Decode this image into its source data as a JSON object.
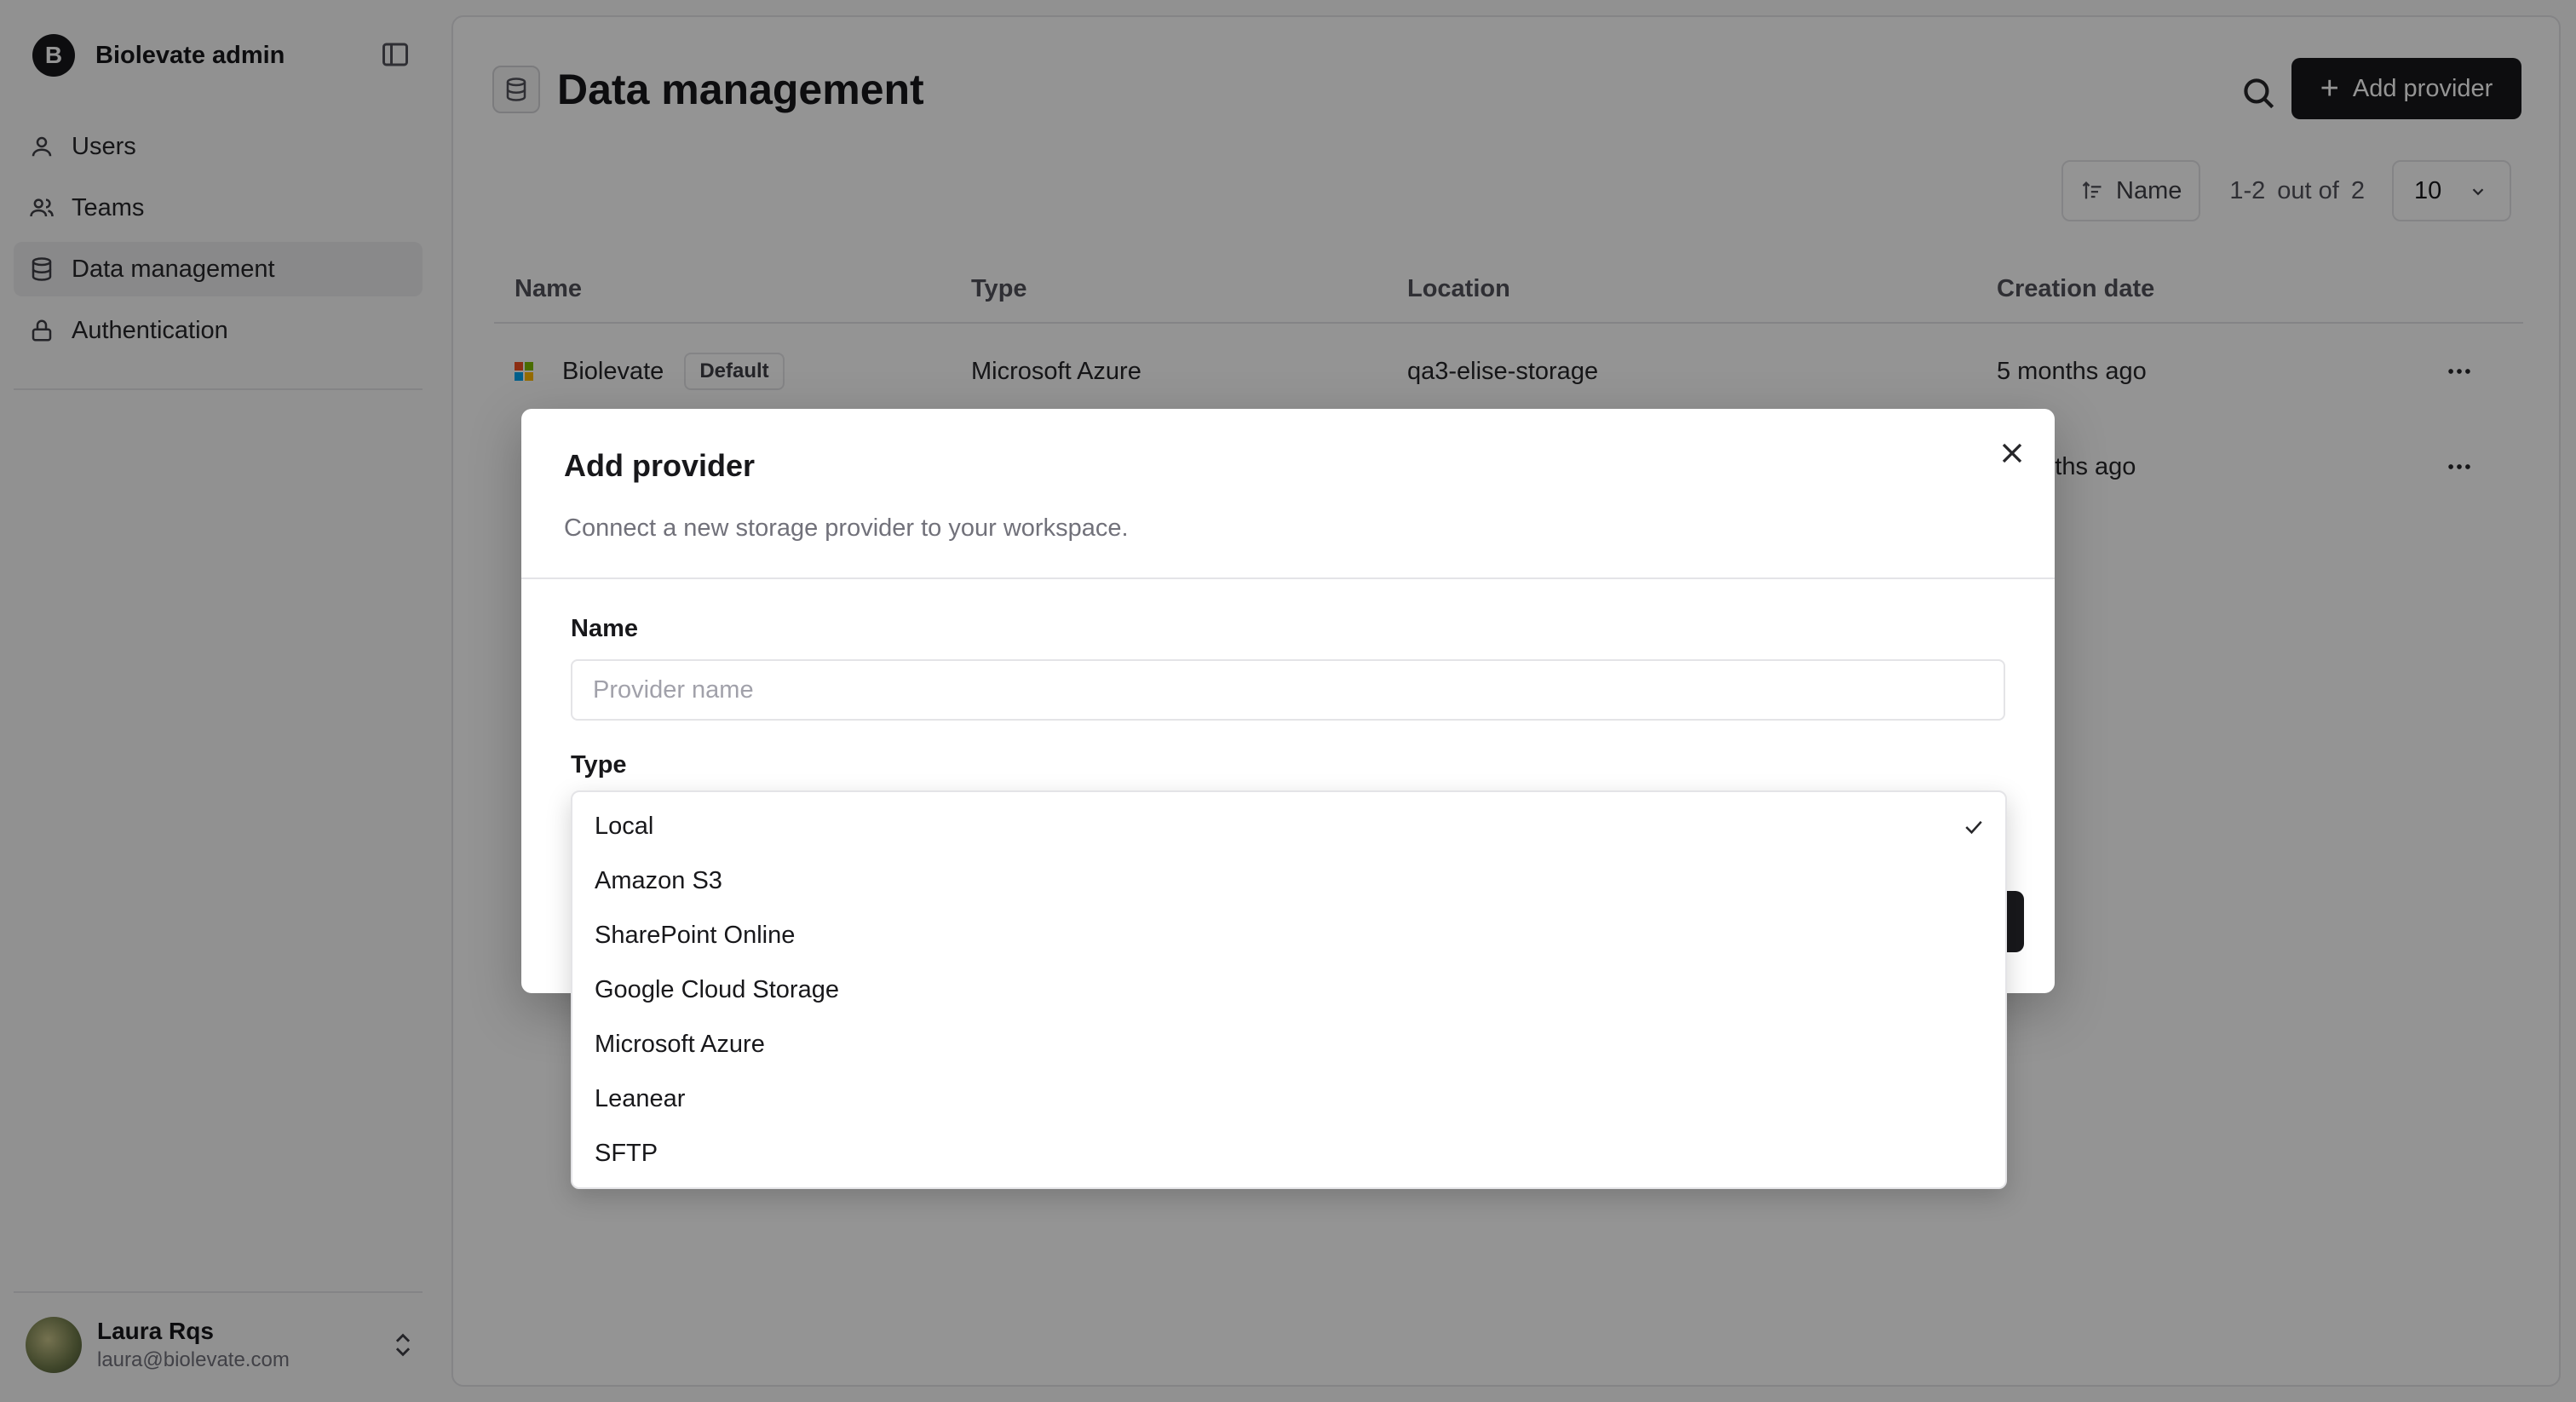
{
  "app": {
    "name": "Biolevate admin",
    "logo_letter": "B"
  },
  "sidebar": {
    "items": [
      {
        "label": "Users",
        "icon": "user-icon",
        "active": false
      },
      {
        "label": "Teams",
        "icon": "users-icon",
        "active": false
      },
      {
        "label": "Data management",
        "icon": "database-icon",
        "active": true
      },
      {
        "label": "Authentication",
        "icon": "lock-icon",
        "active": false
      }
    ],
    "user": {
      "name": "Laura Rqs",
      "email": "laura@biolevate.com"
    }
  },
  "page": {
    "title": "Data management",
    "add_label": "Add provider",
    "sort_label": "Name",
    "pager": {
      "range": "1-2",
      "out_of": "out of",
      "total": "2"
    },
    "page_size": "10"
  },
  "table": {
    "headers": {
      "name": "Name",
      "type": "Type",
      "location": "Location",
      "date": "Creation date"
    },
    "rows": [
      {
        "name": "Biolevate",
        "badge": "Default",
        "type": "Microsoft Azure",
        "location": "qa3-elise-storage",
        "date": "5 months ago"
      },
      {
        "name": "",
        "badge": "",
        "type": "",
        "location": "",
        "date": "onths ago"
      }
    ]
  },
  "dialog": {
    "title": "Add provider",
    "subtitle": "Connect a new storage provider to your workspace.",
    "name_label": "Name",
    "name_placeholder": "Provider name",
    "type_label": "Type",
    "type_options": [
      "Local",
      "Amazon S3",
      "SharePoint Online",
      "Google Cloud Storage",
      "Microsoft Azure",
      "Leanear",
      "SFTP"
    ],
    "selected_type": "Local"
  },
  "colors": {
    "primary": "#18181b",
    "overlay": "rgba(0,0,0,0.42)",
    "muted": "#71717a"
  }
}
